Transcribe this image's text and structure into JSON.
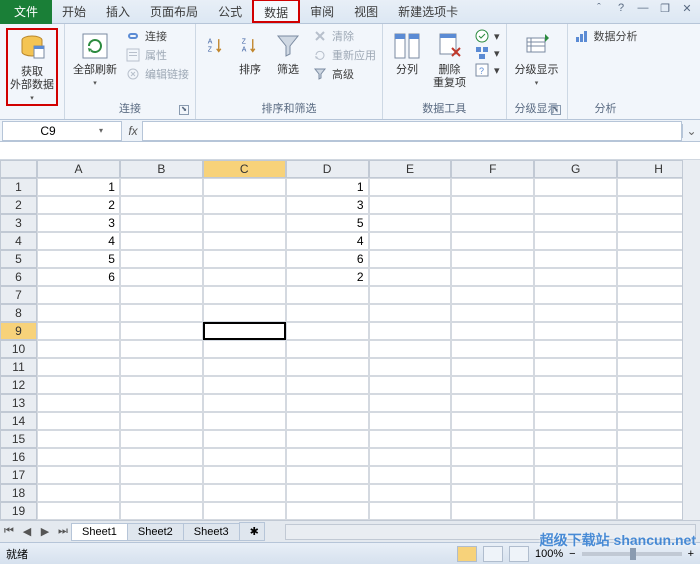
{
  "menu": {
    "file": "文件",
    "tabs": [
      "开始",
      "插入",
      "页面布局",
      "公式",
      "数据",
      "审阅",
      "视图",
      "新建选项卡"
    ],
    "active_tab_index": 4,
    "highlighted_tab_index": 4,
    "help_icon": "?"
  },
  "ribbon": {
    "groups": [
      {
        "label": "",
        "items": [
          {
            "big": true,
            "label": "获取\n外部数据",
            "name": "get-external-data",
            "highlight": true
          }
        ]
      },
      {
        "label": "连接",
        "dialog": true,
        "items": [
          {
            "big": true,
            "label": "全部刷新",
            "name": "refresh-all",
            "dropdown": true
          },
          {
            "small": [
              {
                "label": "连接",
                "name": "connections"
              },
              {
                "label": "属性",
                "name": "properties",
                "disabled": true
              },
              {
                "label": "编辑链接",
                "name": "edit-links",
                "disabled": true
              }
            ]
          }
        ]
      },
      {
        "label": "排序和筛选",
        "items": [
          {
            "big": true,
            "label": "",
            "name": "sort-asc",
            "icon": "az-down"
          },
          {
            "big": true,
            "label": "",
            "name": "sort-desc",
            "icon": "za-down"
          },
          {
            "big": true,
            "label": "排序",
            "name": "sort"
          },
          {
            "big": true,
            "label": "筛选",
            "name": "filter"
          },
          {
            "small": [
              {
                "label": "清除",
                "name": "clear",
                "disabled": true
              },
              {
                "label": "重新应用",
                "name": "reapply",
                "disabled": true
              },
              {
                "label": "高级",
                "name": "advanced"
              }
            ]
          }
        ]
      },
      {
        "label": "数据工具",
        "items": [
          {
            "big": true,
            "label": "分列",
            "name": "text-to-columns"
          },
          {
            "big": true,
            "label": "删除\n重复项",
            "name": "remove-duplicates"
          },
          {
            "big": true,
            "label": "",
            "name": "data-validation",
            "dropdown": true
          },
          {
            "big": true,
            "label": "",
            "name": "consolidate",
            "dropdown": true
          },
          {
            "big": true,
            "label": "",
            "name": "what-if",
            "dropdown": true
          }
        ]
      },
      {
        "label": "分级显示",
        "dialog": true,
        "items": [
          {
            "big": true,
            "label": "分级显示",
            "name": "outline",
            "dropdown": true
          }
        ]
      },
      {
        "label": "分析",
        "items": [
          {
            "small": [
              {
                "label": "数据分析",
                "name": "data-analysis"
              }
            ]
          }
        ]
      }
    ]
  },
  "namebox": {
    "value": "C9"
  },
  "formula": {
    "fx": "fx",
    "value": ""
  },
  "grid": {
    "columns": [
      "A",
      "B",
      "C",
      "D",
      "E",
      "F",
      "G",
      "H"
    ],
    "row_count": 19,
    "selected_cell": {
      "row": 9,
      "col": "C"
    },
    "data": {
      "A": {
        "1": "1",
        "2": "2",
        "3": "3",
        "4": "4",
        "5": "5",
        "6": "6"
      },
      "D": {
        "1": "1",
        "2": "3",
        "3": "5",
        "4": "4",
        "5": "6",
        "6": "2"
      }
    }
  },
  "sheets": {
    "tabs": [
      "Sheet1",
      "Sheet2",
      "Sheet3"
    ],
    "active": 0
  },
  "status": {
    "ready": "就绪",
    "zoom": "100%",
    "zoom_minus": "−",
    "zoom_plus": "+"
  },
  "watermark": "超级下载站 shancun.net"
}
